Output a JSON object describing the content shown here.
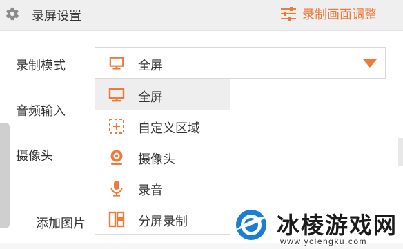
{
  "colors": {
    "accent": "#f07a3a",
    "header_bg": "#efefef",
    "selected_bg": "#eeeeee"
  },
  "header": {
    "title": "录屏设置",
    "title_icon": "gear-icon",
    "adjust_label": "录制画面调整",
    "adjust_icon": "sliders-icon"
  },
  "rows": {
    "record_mode_label": "录制模式",
    "audio_input_label": "音频输入",
    "camera_label": "摄像头",
    "add_image_label": "添加图片"
  },
  "record_mode_select": {
    "value": "全屏",
    "value_icon": "monitor-icon",
    "options": [
      {
        "label": "全屏",
        "icon": "monitor-icon",
        "selected": true
      },
      {
        "label": "自定义区域",
        "icon": "custom-region-icon",
        "selected": false
      },
      {
        "label": "摄像头",
        "icon": "webcam-icon",
        "selected": false
      },
      {
        "label": "录音",
        "icon": "microphone-icon",
        "selected": false
      },
      {
        "label": "分屏录制",
        "icon": "split-screen-icon",
        "selected": false
      }
    ]
  },
  "watermark": {
    "text": "冰棱游戏网",
    "url": "www.yclengku.com"
  }
}
